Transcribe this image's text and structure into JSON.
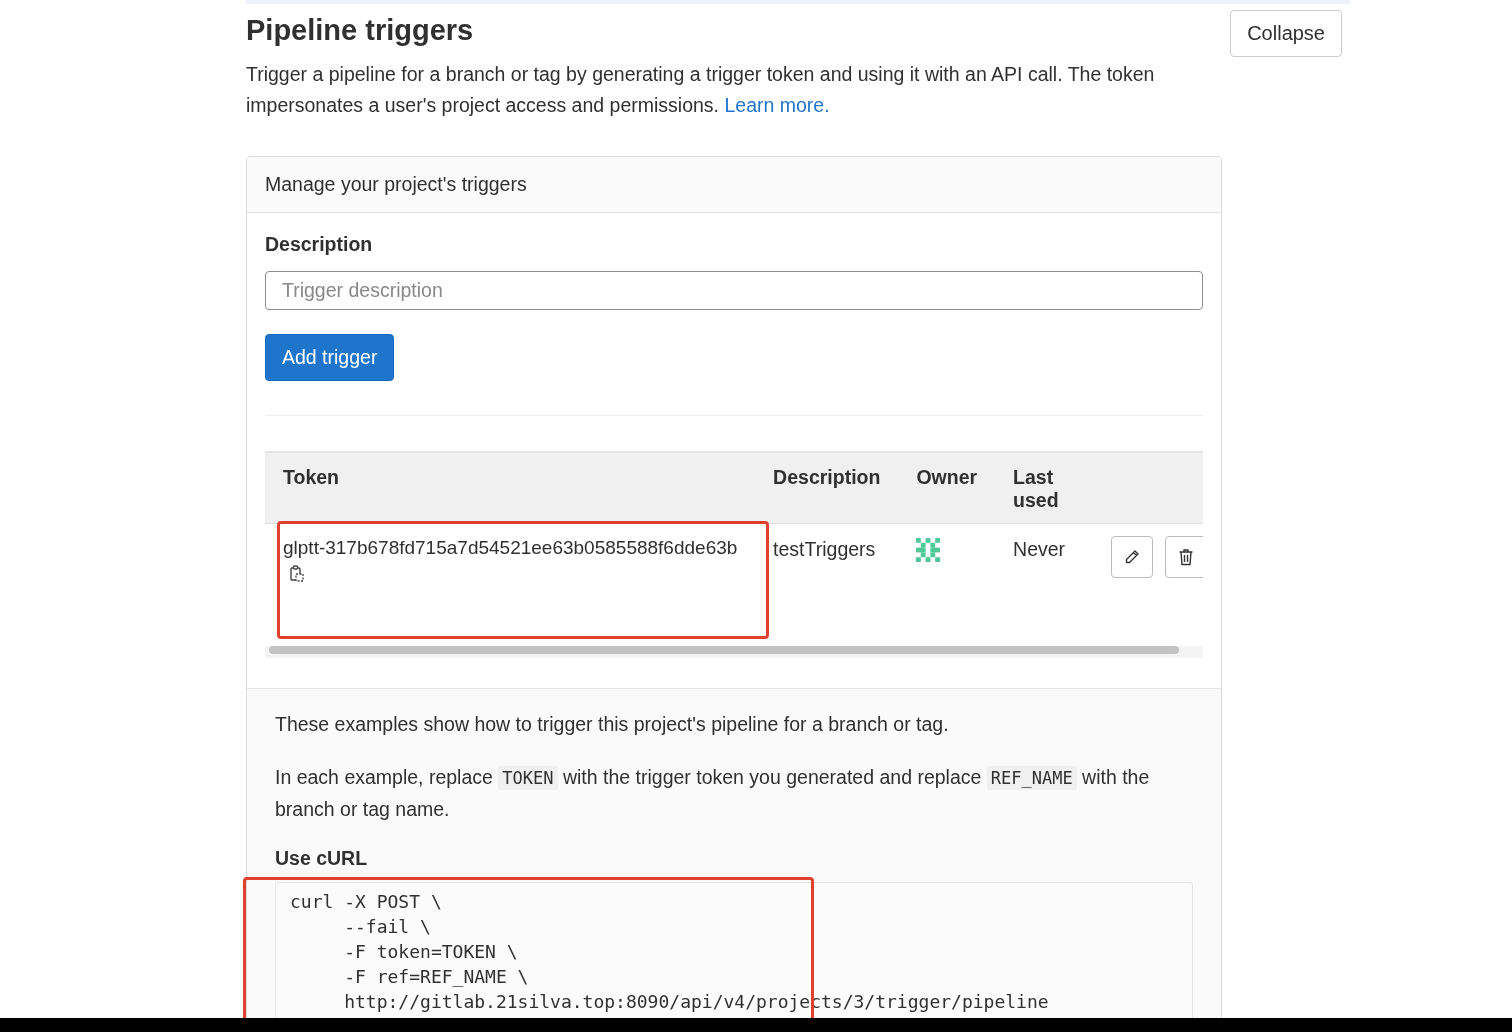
{
  "section": {
    "title": "Pipeline triggers",
    "collapse_button": "Collapse",
    "intro": "Trigger a pipeline for a branch or tag by generating a trigger token and using it with an API call. The token impersonates a user's project access and permissions.",
    "learn_more": "Learn more."
  },
  "card": {
    "header": "Manage your project's triggers",
    "description_label": "Description",
    "description_field": {
      "placeholder": "Trigger description"
    },
    "add_button": "Add trigger"
  },
  "table": {
    "columns": [
      "Token",
      "Description",
      "Owner",
      "Last used"
    ],
    "rows": [
      {
        "token": "glptt-317b678fd715a7d54521ee63b0585588f6dde63b",
        "description": "testTriggers",
        "last_used": "Never",
        "highlighted": true
      }
    ]
  },
  "examples": {
    "intro": "These examples show how to trigger this project's pipeline for a branch or tag.",
    "replace_parts": [
      "In each example, replace ",
      "TOKEN",
      " with the trigger token you generated and replace ",
      "REF_NAME",
      " with the branch or tag name."
    ],
    "curl_heading": "Use cURL",
    "curl_lines": [
      "curl -X POST \\",
      "     --fail \\",
      "     -F token=TOKEN \\",
      "     -F ref=REF_NAME \\",
      "     http://gitlab.21silva.top:8090/api/v4/projects/3/trigger/pipeline"
    ],
    "curl_highlighted": true
  }
}
